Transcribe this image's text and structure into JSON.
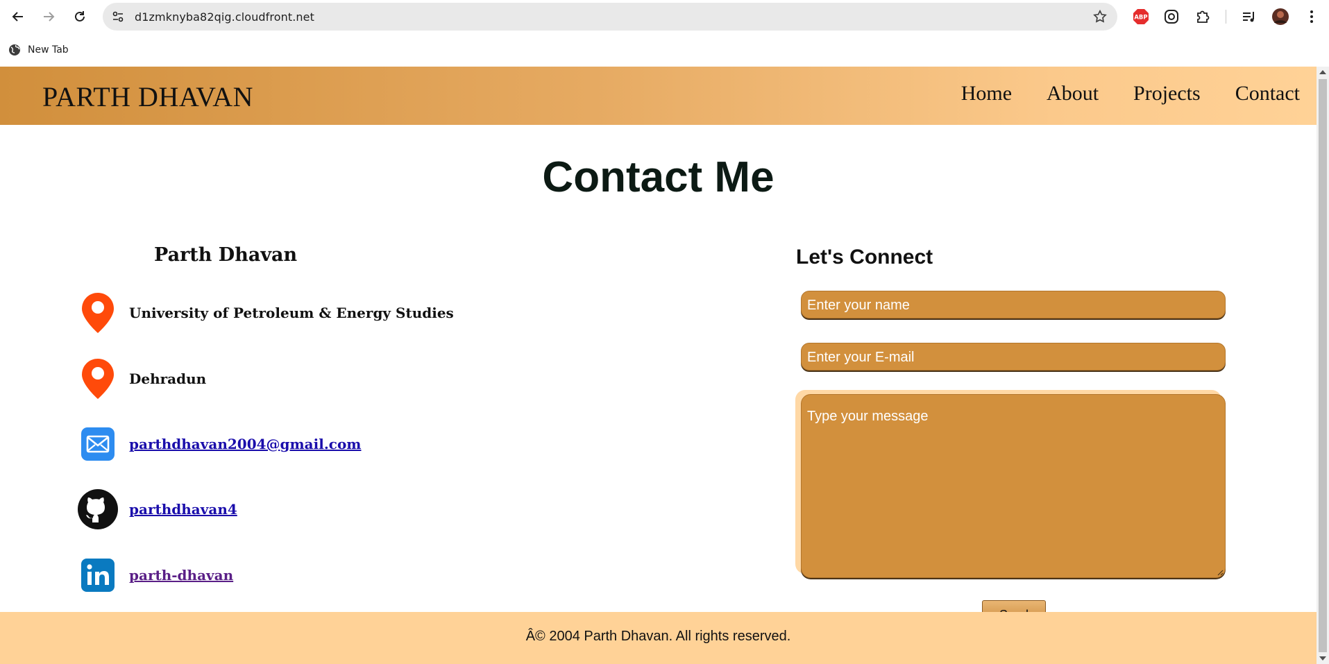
{
  "browser": {
    "url": "d1zmknyba82qig.cloudfront.net",
    "bookmarks": [
      {
        "label": "New Tab",
        "icon": "globe-icon"
      }
    ],
    "extensions": [
      "adblock-plus-icon",
      "ublock-icon",
      "puzzle-extensions-icon",
      "media-controls-icon",
      "profile-avatar",
      "kebab-menu-icon"
    ]
  },
  "site": {
    "brand": "PARTH DHAVAN",
    "nav": [
      "Home",
      "About",
      "Projects",
      "Contact"
    ],
    "page_title": "Contact Me",
    "contact": {
      "name": "Parth Dhavan",
      "items": [
        {
          "icon": "location-pin-icon",
          "text": "University of Petroleum & Energy Studies",
          "link": false
        },
        {
          "icon": "location-pin-icon",
          "text": "Dehradun",
          "link": false
        },
        {
          "icon": "mail-icon",
          "text": "parthdhavan2004@gmail.com",
          "link": true
        },
        {
          "icon": "github-icon",
          "text": "parthdhavan4",
          "link": true
        },
        {
          "icon": "linkedin-icon",
          "text": "parth-dhavan",
          "link": true,
          "visited": true
        }
      ]
    },
    "form": {
      "title": "Let's Connect",
      "name_placeholder": "Enter your name",
      "email_placeholder": "Enter your E-mail",
      "message_placeholder": "Type your message",
      "send_label": "Send"
    },
    "footer": "Â© 2004 Parth Dhavan. All rights reserved."
  },
  "colors": {
    "accent": "#d2903d",
    "footer": "#ffd297",
    "pin": "#ff4a0a",
    "mail": "#2d8cf0",
    "linkedin": "#0a7ac0"
  }
}
